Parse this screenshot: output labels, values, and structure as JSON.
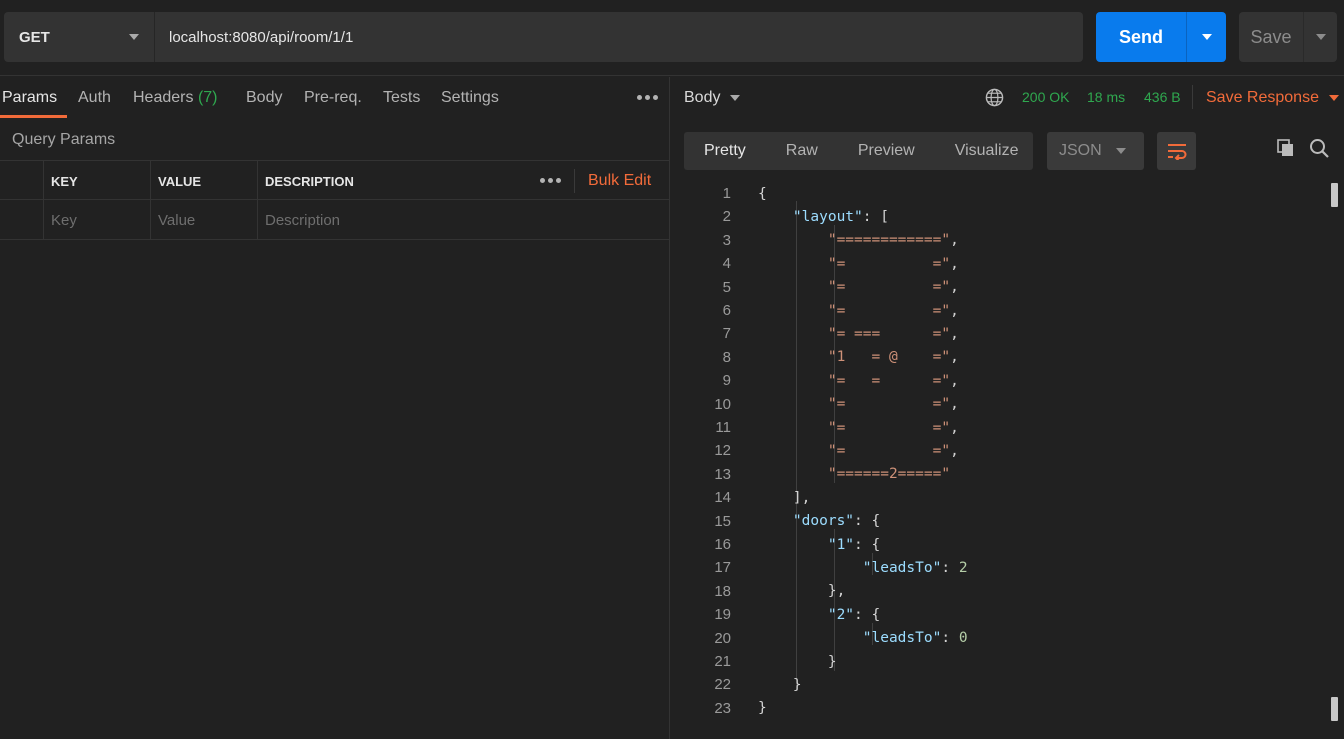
{
  "request": {
    "method": "GET",
    "url": "localhost:8080/api/room/1/1",
    "send_label": "Send",
    "save_label": "Save"
  },
  "request_tabs": {
    "params": "Params",
    "auth": "Auth",
    "headers": "Headers",
    "headers_count": "(7)",
    "body": "Body",
    "prereq": "Pre-req.",
    "tests": "Tests",
    "settings": "Settings"
  },
  "query_params": {
    "title": "Query Params",
    "columns": [
      "KEY",
      "VALUE",
      "DESCRIPTION"
    ],
    "bulk_edit": "Bulk Edit",
    "placeholders": {
      "key": "Key",
      "value": "Value",
      "description": "Description"
    }
  },
  "response": {
    "body_label": "Body",
    "status": "200 OK",
    "time": "18 ms",
    "size": "436 B",
    "save_response": "Save Response",
    "views": [
      "Pretty",
      "Raw",
      "Preview",
      "Visualize"
    ],
    "active_view": "Pretty",
    "format": "JSON"
  },
  "colors": {
    "accent": "#f26b3a",
    "send": "#097bed",
    "status_ok": "#2fa84f",
    "json_key": "#9cdcfe",
    "json_string": "#ce9178",
    "json_number": "#b5cea8"
  },
  "icons": [
    "chevron-down-icon",
    "more-horizontal-icon",
    "globe-icon",
    "wrap-lines-icon",
    "copy-icon",
    "search-icon"
  ],
  "code_lines": [
    {
      "n": "1",
      "parts": [
        [
          "p",
          "{"
        ]
      ]
    },
    {
      "n": "2",
      "parts": [
        [
          "p",
          "    "
        ],
        [
          "k",
          "\"layout\""
        ],
        [
          "p",
          ": ["
        ]
      ]
    },
    {
      "n": "3",
      "parts": [
        [
          "p",
          "        "
        ],
        [
          "s",
          "\"============\""
        ],
        [
          "p",
          ","
        ]
      ]
    },
    {
      "n": "4",
      "parts": [
        [
          "p",
          "        "
        ],
        [
          "s",
          "\"=          =\""
        ],
        [
          "p",
          ","
        ]
      ]
    },
    {
      "n": "5",
      "parts": [
        [
          "p",
          "        "
        ],
        [
          "s",
          "\"=          =\""
        ],
        [
          "p",
          ","
        ]
      ]
    },
    {
      "n": "6",
      "parts": [
        [
          "p",
          "        "
        ],
        [
          "s",
          "\"=          =\""
        ],
        [
          "p",
          ","
        ]
      ]
    },
    {
      "n": "7",
      "parts": [
        [
          "p",
          "        "
        ],
        [
          "s",
          "\"= ===      =\""
        ],
        [
          "p",
          ","
        ]
      ]
    },
    {
      "n": "8",
      "parts": [
        [
          "p",
          "        "
        ],
        [
          "s",
          "\"1   = @    =\""
        ],
        [
          "p",
          ","
        ]
      ]
    },
    {
      "n": "9",
      "parts": [
        [
          "p",
          "        "
        ],
        [
          "s",
          "\"=   =      =\""
        ],
        [
          "p",
          ","
        ]
      ]
    },
    {
      "n": "10",
      "parts": [
        [
          "p",
          "        "
        ],
        [
          "s",
          "\"=          =\""
        ],
        [
          "p",
          ","
        ]
      ]
    },
    {
      "n": "11",
      "parts": [
        [
          "p",
          "        "
        ],
        [
          "s",
          "\"=          =\""
        ],
        [
          "p",
          ","
        ]
      ]
    },
    {
      "n": "12",
      "parts": [
        [
          "p",
          "        "
        ],
        [
          "s",
          "\"=          =\""
        ],
        [
          "p",
          ","
        ]
      ]
    },
    {
      "n": "13",
      "parts": [
        [
          "p",
          "        "
        ],
        [
          "s",
          "\"======2=====\""
        ]
      ]
    },
    {
      "n": "14",
      "parts": [
        [
          "p",
          "    ],"
        ]
      ]
    },
    {
      "n": "15",
      "parts": [
        [
          "p",
          "    "
        ],
        [
          "k",
          "\"doors\""
        ],
        [
          "p",
          ": {"
        ]
      ]
    },
    {
      "n": "16",
      "parts": [
        [
          "p",
          "        "
        ],
        [
          "k",
          "\"1\""
        ],
        [
          "p",
          ": {"
        ]
      ]
    },
    {
      "n": "17",
      "parts": [
        [
          "p",
          "            "
        ],
        [
          "k",
          "\"leadsTo\""
        ],
        [
          "p",
          ": "
        ],
        [
          "n",
          "2"
        ]
      ]
    },
    {
      "n": "18",
      "parts": [
        [
          "p",
          "        },"
        ]
      ]
    },
    {
      "n": "19",
      "parts": [
        [
          "p",
          "        "
        ],
        [
          "k",
          "\"2\""
        ],
        [
          "p",
          ": {"
        ]
      ]
    },
    {
      "n": "20",
      "parts": [
        [
          "p",
          "            "
        ],
        [
          "k",
          "\"leadsTo\""
        ],
        [
          "p",
          ": "
        ],
        [
          "n",
          "0"
        ]
      ]
    },
    {
      "n": "21",
      "parts": [
        [
          "p",
          "        }"
        ]
      ]
    },
    {
      "n": "22",
      "parts": [
        [
          "p",
          "    }"
        ]
      ]
    },
    {
      "n": "23",
      "parts": [
        [
          "p",
          "}"
        ]
      ]
    }
  ]
}
